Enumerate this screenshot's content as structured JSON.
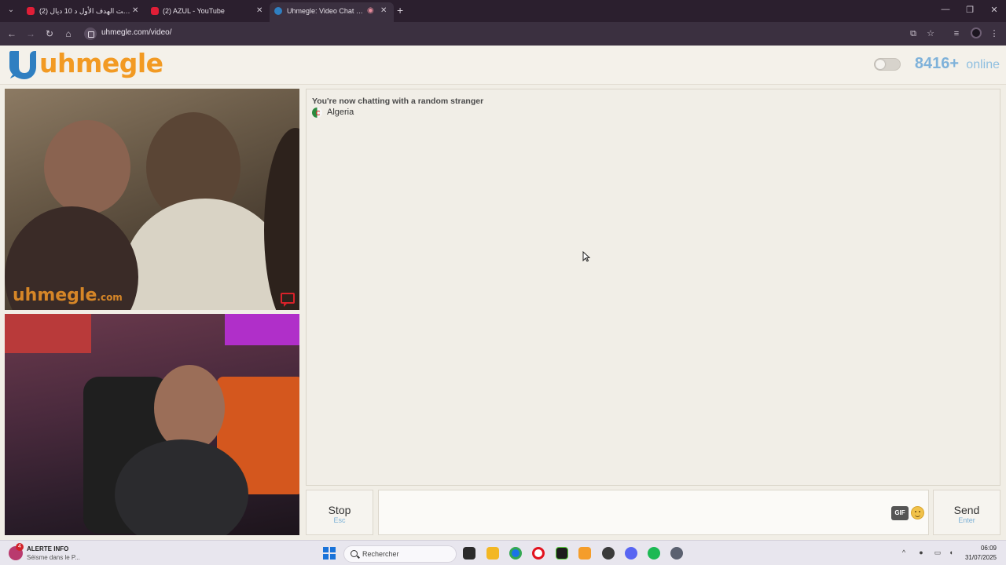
{
  "browser": {
    "tabs": [
      {
        "title": "(2) حققت الهدف الأول د 10 ديال",
        "active": false
      },
      {
        "title": "(2) AZUL - YouTube",
        "active": false
      },
      {
        "title": "Uhmegle: Video Chat | Ome",
        "active": true
      }
    ],
    "url": "uhmegle.com/video/"
  },
  "header": {
    "logo_text": "uhmegle",
    "online_count": "8416+",
    "online_label": "online"
  },
  "video": {
    "watermark": "uhmegle",
    "watermark_suffix": ".com"
  },
  "chat": {
    "status_message": "You're now chatting with a random stranger",
    "country": "Algeria",
    "stop_label": "Stop",
    "stop_key": "Esc",
    "send_label": "Send",
    "send_key": "Enter",
    "gif_label": "GIF",
    "message_placeholder": ""
  },
  "taskbar": {
    "news_badge": "4",
    "news_title": "ALERTE INFO",
    "news_subtitle": "Séisme dans le P...",
    "search_label": "Rechercher",
    "time": "06:09",
    "date": "31/07/2025"
  },
  "colors": {
    "brand_orange": "#f29a23",
    "brand_blue": "#2f7fc1",
    "online_blue": "#7fb2da"
  }
}
